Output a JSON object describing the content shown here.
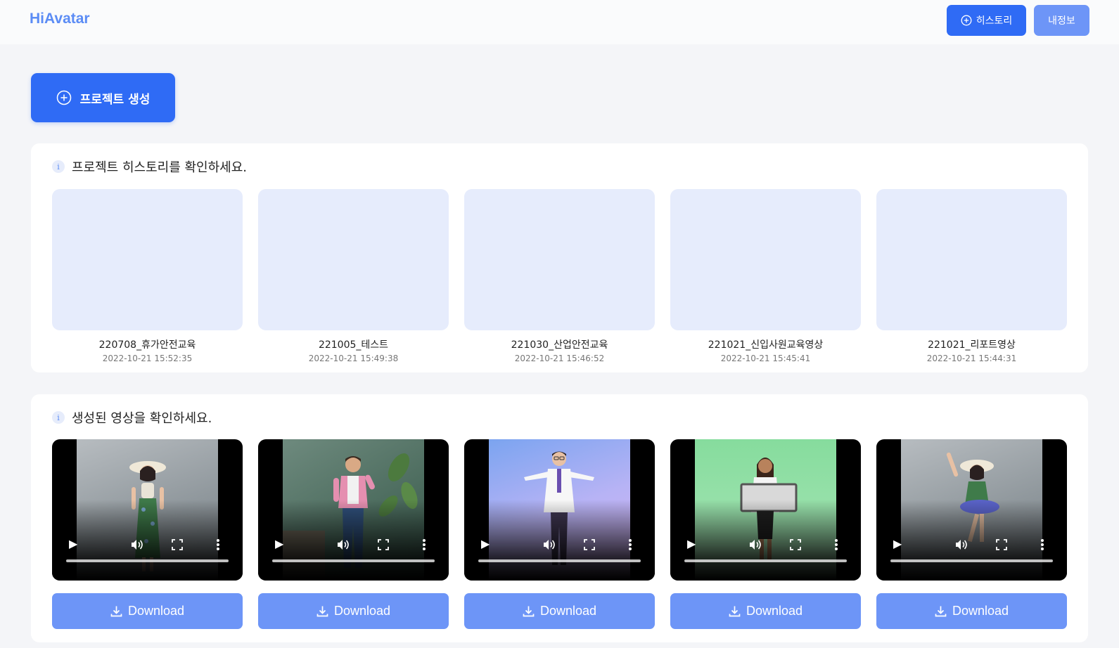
{
  "header": {
    "logo": "HiAvatar",
    "history_button": "히스토리",
    "myinfo_button": "내정보"
  },
  "create_button": "프로젝트 생성",
  "history_panel": {
    "heading": "프로젝트 히스토리를 확인하세요.",
    "projects": [
      {
        "title": "220708_휴가안전교육",
        "date": "2022-10-21 15:52:35"
      },
      {
        "title": "221005_테스트",
        "date": "2022-10-21 15:49:38"
      },
      {
        "title": "221030_산업안전교육",
        "date": "2022-10-21 15:46:52"
      },
      {
        "title": "221021_신입사원교육영상",
        "date": "2022-10-21 15:45:41"
      },
      {
        "title": "221021_리포트영상",
        "date": "2022-10-21 15:44:31"
      }
    ]
  },
  "videos_panel": {
    "heading": "생성된 영상을 확인하세요.",
    "download_label": "Download",
    "videos": [
      {
        "scene": "woman-sunhat-floral-dress",
        "background": "#9fa7ad"
      },
      {
        "scene": "man-pink-shirt-plant",
        "background": "#4f6f62"
      },
      {
        "scene": "doctor-white-coat",
        "background": "#b9b7f1"
      },
      {
        "scene": "woman-holding-sign",
        "background": "#86dc9d"
      },
      {
        "scene": "woman-sunhat-waving",
        "background": "#9fa7ad"
      }
    ]
  },
  "colors": {
    "primary": "#2f6bf5",
    "secondary": "#6d95f7",
    "thumb": "#e6ecfc"
  }
}
